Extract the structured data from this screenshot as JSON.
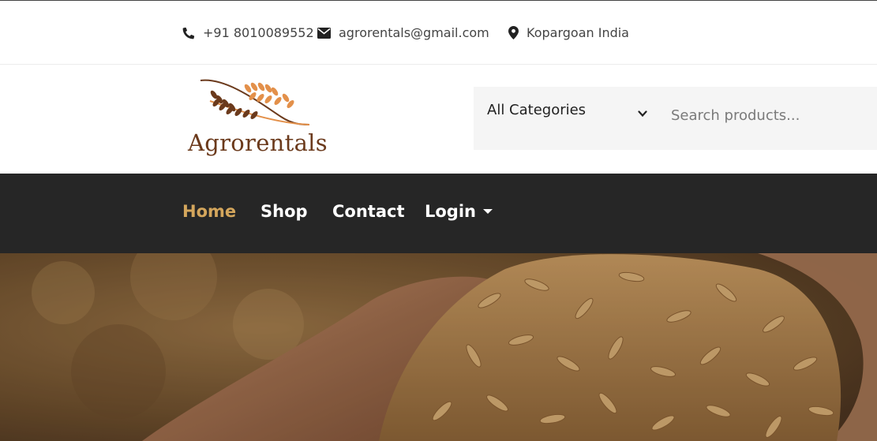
{
  "topbar": {
    "phone": "+91 8010089552",
    "email": "agrorentals@gmail.com",
    "location": "Kopargoan India",
    "phone_icon": "phone-icon",
    "email_icon": "envelope-icon",
    "location_icon": "map-marker-icon"
  },
  "logo": {
    "text": "Agrorentals"
  },
  "search": {
    "category": "All Categories",
    "placeholder": "Search products..."
  },
  "nav": {
    "items": [
      {
        "label": "Home",
        "active": true
      },
      {
        "label": "Shop"
      },
      {
        "label": "Contact"
      },
      {
        "label": "Login",
        "has_dropdown": true
      }
    ]
  },
  "colors": {
    "accent": "#d4a65c",
    "nav_bg": "#262626",
    "brand_brown": "#6b3a1c",
    "grain_orange": "#e3904a"
  }
}
